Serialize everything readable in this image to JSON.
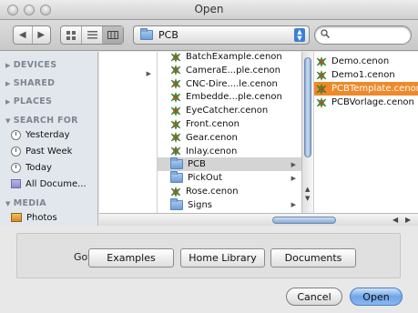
{
  "window": {
    "title": "Open"
  },
  "toolbar": {
    "back_icon": "back-arrow",
    "forward_icon": "forward-arrow",
    "view_modes": [
      "icon-view",
      "list-view",
      "column-view"
    ],
    "active_view": "column-view",
    "location": "PCB",
    "search_placeholder": ""
  },
  "sidebar": {
    "devices": "DEVICES",
    "shared": "SHARED",
    "places": "PLACES",
    "search_for": "SEARCH FOR",
    "search_items": [
      "Yesterday",
      "Past Week",
      "Today",
      "All Docume..."
    ],
    "media": "MEDIA",
    "media_items": [
      "Photos"
    ]
  },
  "columns": {
    "col2": [
      {
        "name": "BatchExample.cenon",
        "kind": "file"
      },
      {
        "name": "CameraE...ple.cenon",
        "kind": "file"
      },
      {
        "name": "CNC-Dire....le.cenon",
        "kind": "file"
      },
      {
        "name": "Embedde...ple.cenon",
        "kind": "file"
      },
      {
        "name": "EyeCatcher.cenon",
        "kind": "file"
      },
      {
        "name": "Front.cenon",
        "kind": "file"
      },
      {
        "name": "Gear.cenon",
        "kind": "file"
      },
      {
        "name": "Inlay.cenon",
        "kind": "file"
      },
      {
        "name": "PCB",
        "kind": "folder"
      },
      {
        "name": "PickOut",
        "kind": "folder"
      },
      {
        "name": "Rose.cenon",
        "kind": "file"
      },
      {
        "name": "Signs",
        "kind": "folder"
      }
    ],
    "col3": [
      {
        "name": "Demo.cenon"
      },
      {
        "name": "Demo1.cenon"
      },
      {
        "name": "PCBTemplate.cenon"
      },
      {
        "name": "PCBVorlage.cenon"
      }
    ],
    "selected_folder": "PCB",
    "selected_file": "PCBTemplate.cenon"
  },
  "goto": {
    "label": "Goto:",
    "buttons": [
      "Examples",
      "Home Library",
      "Documents"
    ]
  },
  "actions": {
    "cancel": "Cancel",
    "open": "Open"
  },
  "colors": {
    "selection": "#ee8a2a",
    "sidebar_bg": "#e2e7ed",
    "default_button": "#6ea4e8"
  }
}
